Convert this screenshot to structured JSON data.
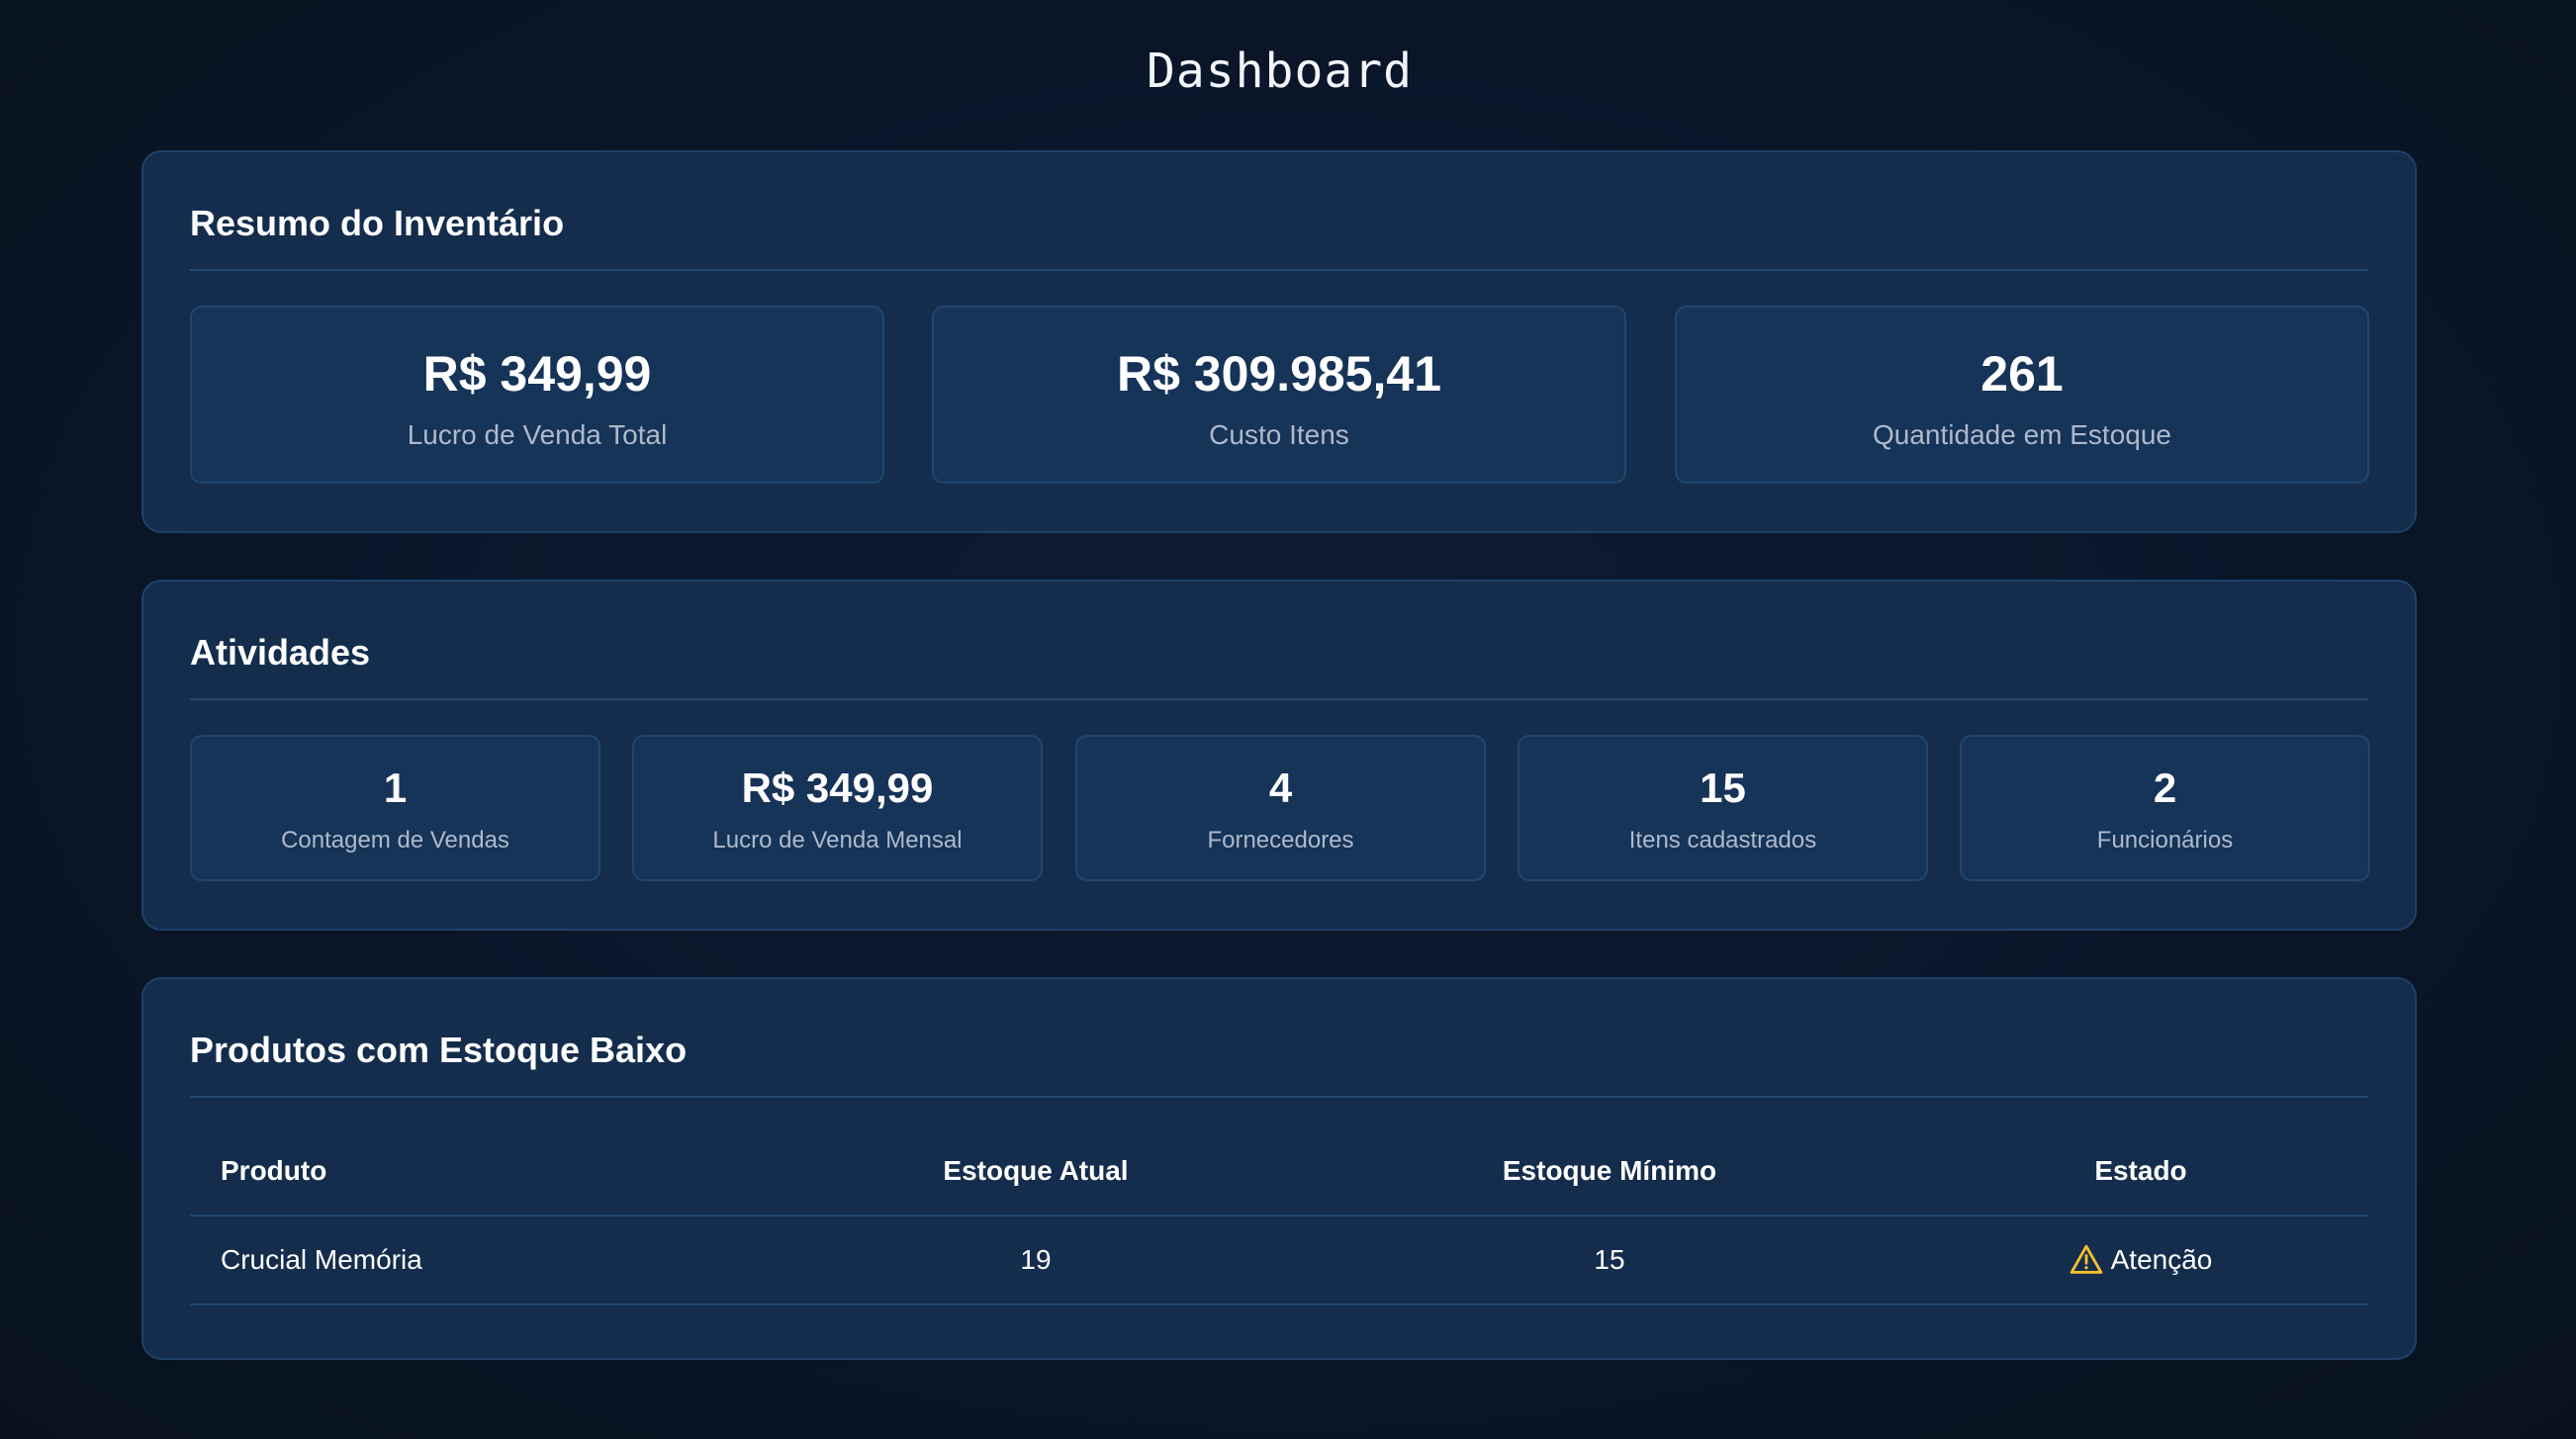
{
  "page": {
    "title": "Dashboard"
  },
  "inventory_summary": {
    "heading": "Resumo do Inventário",
    "cards": [
      {
        "value": "R$ 349,99",
        "label": "Lucro de Venda Total"
      },
      {
        "value": "R$ 309.985,41",
        "label": "Custo Itens"
      },
      {
        "value": "261",
        "label": "Quantidade em Estoque"
      }
    ]
  },
  "activities": {
    "heading": "Atividades",
    "cards": [
      {
        "value": "1",
        "label": "Contagem de Vendas"
      },
      {
        "value": "R$ 349,99",
        "label": "Lucro de Venda Mensal"
      },
      {
        "value": "4",
        "label": "Fornecedores"
      },
      {
        "value": "15",
        "label": "Itens cadastrados"
      },
      {
        "value": "2",
        "label": "Funcionários"
      }
    ]
  },
  "low_stock": {
    "heading": "Produtos com Estoque Baixo",
    "columns": [
      "Produto",
      "Estoque Atual",
      "Estoque Mínimo",
      "Estado"
    ],
    "rows": [
      {
        "produto": "Crucial Memória",
        "estoque_atual": "19",
        "estoque_minimo": "15",
        "estado": "Atenção",
        "estado_icon": "warning-triangle-icon"
      }
    ]
  },
  "colors": {
    "background": "#0a1628",
    "panel": "#142d4d",
    "card": "#163358",
    "border": "#1f4168",
    "muted_text": "#aebacb",
    "warning": "#f2c12e"
  }
}
